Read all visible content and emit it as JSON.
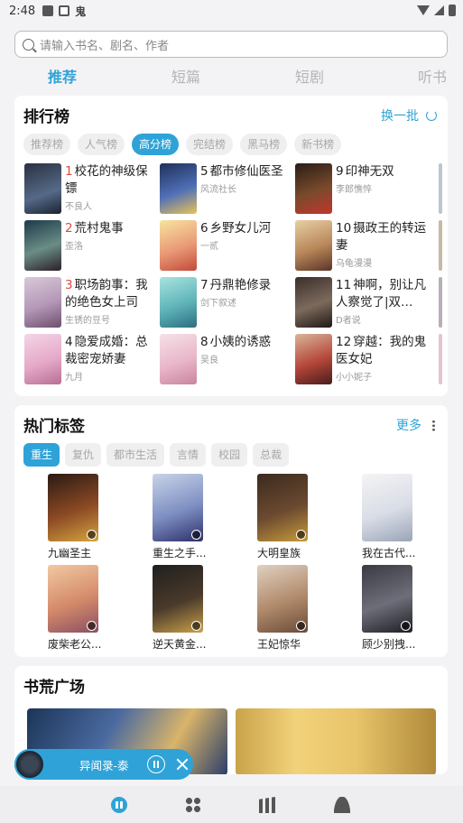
{
  "status": {
    "time": "2:48",
    "app_char": "鬼"
  },
  "search": {
    "placeholder": "请输入书名、剧名、作者"
  },
  "tabs": [
    "推荐",
    "短篇",
    "短剧",
    "听书"
  ],
  "ranking": {
    "title": "排行榜",
    "swap_label": "换一批",
    "chips": [
      "推荐榜",
      "人气榜",
      "高分榜",
      "完结榜",
      "黑马榜",
      "新书榜"
    ],
    "active_chip": "高分榜",
    "items": [
      {
        "num": "1",
        "title": "校花的神级保镖",
        "author": "不良人"
      },
      {
        "num": "2",
        "title": "荒村鬼事",
        "author": "歪洛"
      },
      {
        "num": "3",
        "title": "职场韵事：我的绝色女上司",
        "author": "生锈的豆号"
      },
      {
        "num": "4",
        "title": "隐爱成婚：总裁密宠娇妻",
        "author": "九月"
      },
      {
        "num": "5",
        "title": "都市修仙医圣",
        "author": "风流社长"
      },
      {
        "num": "6",
        "title": "乡野女儿河",
        "author": "一贰"
      },
      {
        "num": "7",
        "title": "丹鼎艳修录",
        "author": "剑下叙述"
      },
      {
        "num": "8",
        "title": "小姨的诱惑",
        "author": "吴良"
      },
      {
        "num": "9",
        "title": "印神无双",
        "author": "李郎憔悴"
      },
      {
        "num": "10",
        "title": "摄政王的转运妻",
        "author": "乌龟漫漫"
      },
      {
        "num": "11",
        "title": "神啊，别让凡人察觉了|双…",
        "author": "D者说"
      },
      {
        "num": "12",
        "title": "穿越：我的鬼医女妃",
        "author": "小小妮子"
      }
    ]
  },
  "tags": {
    "title": "热门标签",
    "more_label": "更多",
    "chips": [
      "重生",
      "复仇",
      "都市生活",
      "言情",
      "校园",
      "总裁"
    ],
    "active_chip": "重生",
    "items": [
      {
        "title": "九幽圣主"
      },
      {
        "title": "重生之手..."
      },
      {
        "title": "大明皇族"
      },
      {
        "title": "我在古代..."
      },
      {
        "title": "废柴老公..."
      },
      {
        "title": "逆天黄金..."
      },
      {
        "title": "王妃惊华"
      },
      {
        "title": "顾少别拽..."
      }
    ]
  },
  "plaza": {
    "title": "书荒广场"
  },
  "player": {
    "title": "异闻录-泰"
  },
  "colors": {
    "accent": "#2fa3d8",
    "top_rank": "#e0483e"
  },
  "nav": [
    {
      "name": "home",
      "icon": "home-icon"
    },
    {
      "name": "category",
      "icon": "grid-icon"
    },
    {
      "name": "bookshelf",
      "icon": "shelf-icon"
    },
    {
      "name": "profile",
      "icon": "user-icon"
    }
  ]
}
